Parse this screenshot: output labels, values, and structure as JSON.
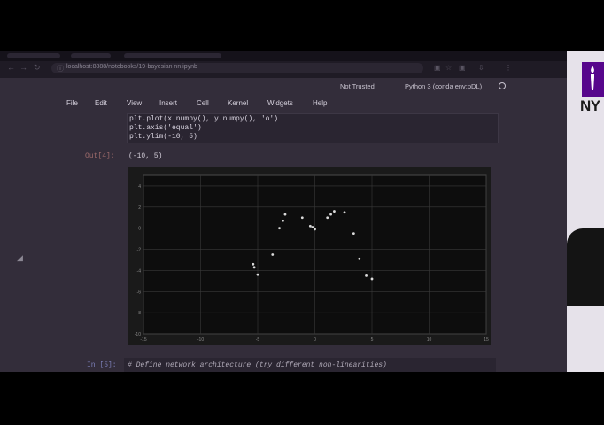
{
  "browser": {
    "url": "localhost:8888/notebooks/19-bayesian nn.ipynb",
    "nav_icons": [
      "back-icon",
      "forward-icon",
      "reload-icon"
    ],
    "extension_icons": [
      "camera-icon",
      "star-icon",
      "puzzle-icon",
      "download-icon",
      "menu-icon"
    ]
  },
  "notebook": {
    "trust_status": "Not Trusted",
    "kernel": "Python 3 (conda env:pDL)",
    "menu": [
      "File",
      "Edit",
      "View",
      "Insert",
      "Cell",
      "Kernel",
      "Widgets",
      "Help"
    ],
    "code_lines": [
      "plt.plot(x.numpy(), y.numpy(), 'o')",
      "plt.axis('equal')",
      "plt.ylim(-10, 5)"
    ],
    "out_prompt": "Out[4]:",
    "out_value": "(-10, 5)",
    "next_in_prompt": "In [5]:",
    "next_code": "# Define network architecture (try different non-linearities)"
  },
  "chart_data": {
    "type": "scatter",
    "xlim": [
      -15,
      15
    ],
    "ylim": [
      -10,
      5
    ],
    "x_ticks": [
      "-15",
      "-10",
      "-5",
      "0",
      "5",
      "10",
      "15"
    ],
    "y_ticks": [
      "4",
      "2",
      "0",
      "-2",
      "-4",
      "-6",
      "-8",
      "-10"
    ],
    "grid": true,
    "series": [
      {
        "color": "#ffffff",
        "x": [
          -5.4,
          -5.3,
          -5.0,
          -3.7,
          -3.1,
          -2.8,
          -2.6,
          -1.1,
          -0.4,
          -0.2,
          0.0,
          1.1,
          1.4,
          1.7,
          2.6,
          3.4,
          3.9,
          4.5,
          5.0
        ],
        "y": [
          -3.4,
          -3.7,
          -4.4,
          -2.5,
          0.0,
          0.7,
          1.3,
          1.0,
          0.2,
          0.1,
          -0.1,
          1.0,
          1.3,
          1.6,
          1.5,
          -0.5,
          -2.9,
          -4.5,
          -4.8
        ]
      }
    ]
  },
  "brand": {
    "logo_text": "NY",
    "colors": {
      "page_bg": "#332d3a",
      "figure_bg": "#1a1a1a",
      "nyu_purple": "#57068c"
    }
  }
}
